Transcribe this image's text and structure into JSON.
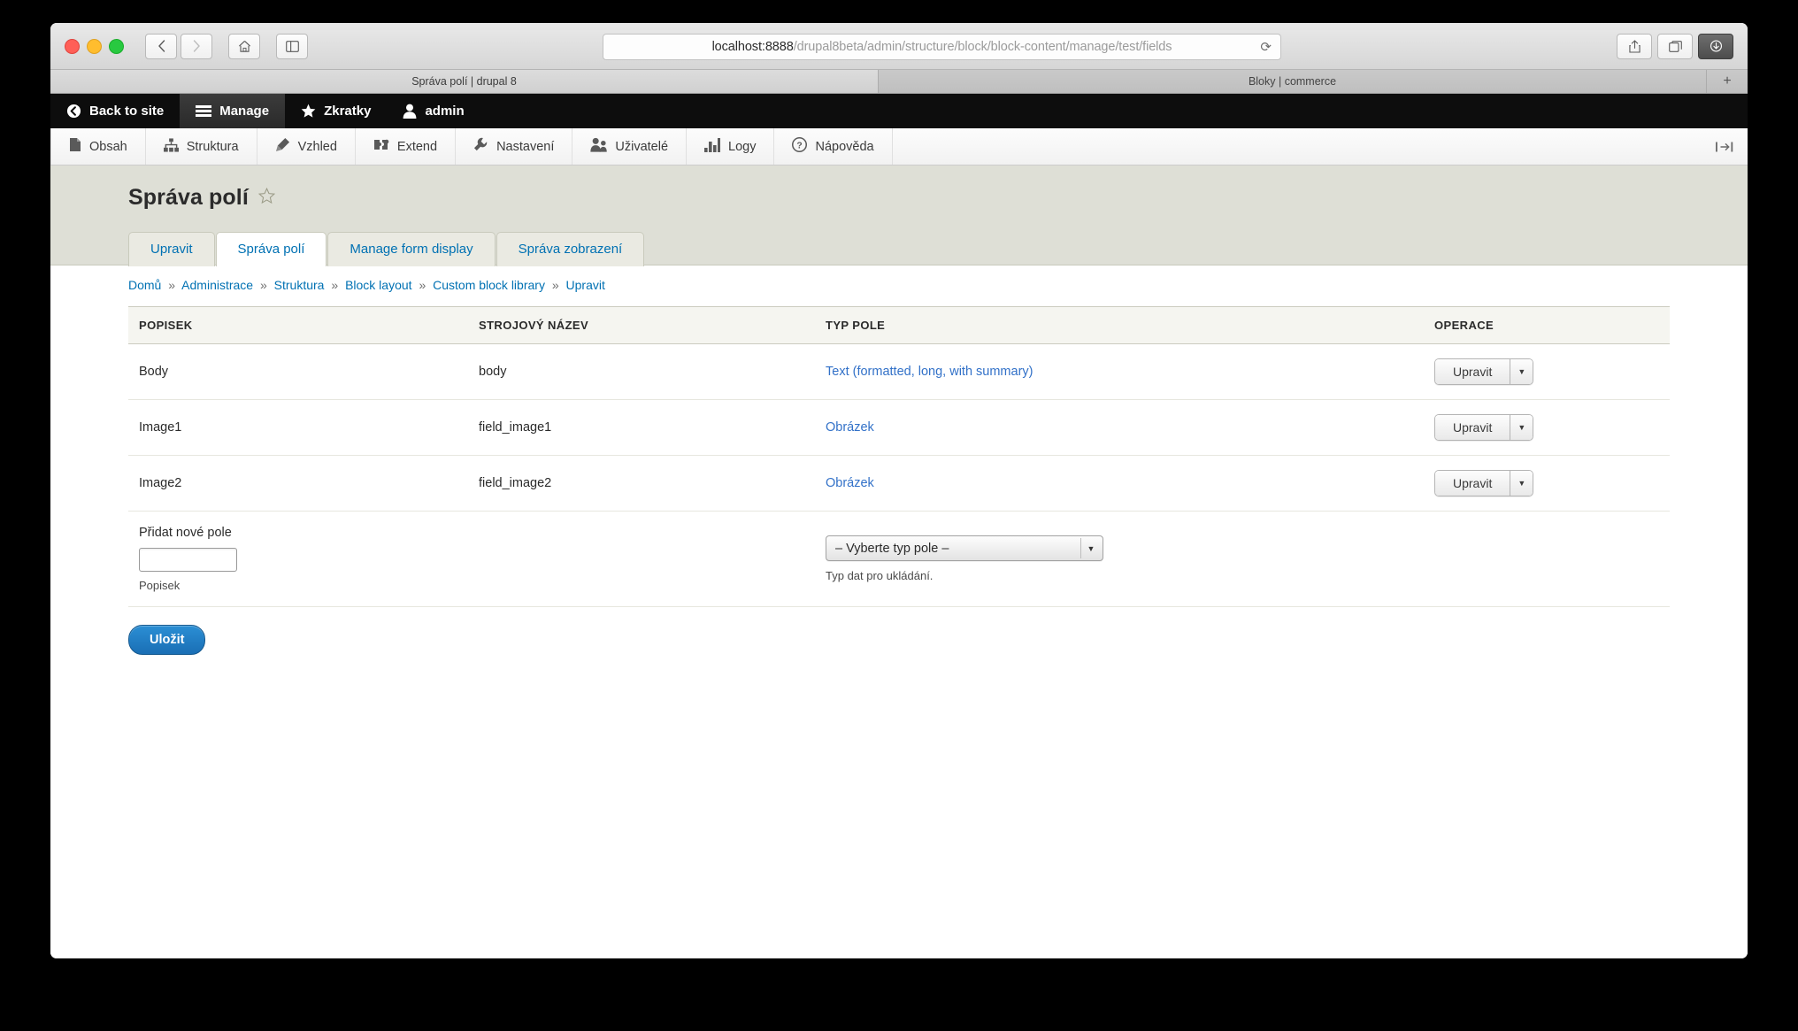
{
  "browser": {
    "url_host": "localhost:8888",
    "url_path": "/drupal8beta/admin/structure/block/block-content/manage/test/fields",
    "reload_icon": "reload-icon",
    "nav_back_icon": "back-arrow-icon",
    "nav_forward_icon": "forward-arrow-icon",
    "home_icon": "home-icon",
    "sidebar_icon": "sidebar-toggle-icon",
    "share_icon": "share-icon",
    "tabs_icon": "new-tab-icon",
    "download_icon": "download-icon",
    "tab_active_title": "Správa polí | drupal 8",
    "tab_second_title": "Bloky | commerce",
    "new_tab_label": "+"
  },
  "toolbar": {
    "back_to_site": "Back to site",
    "manage": "Manage",
    "shortcuts": "Zkratky",
    "account": "admin"
  },
  "admin_menu": {
    "items": [
      {
        "label": "Obsah",
        "icon": "content-page-icon"
      },
      {
        "label": "Struktura",
        "icon": "structure-sitemap-icon"
      },
      {
        "label": "Vzhled",
        "icon": "appearance-brush-icon"
      },
      {
        "label": "Extend",
        "icon": "extend-puzzle-icon"
      },
      {
        "label": "Nastavení",
        "icon": "settings-wrench-icon"
      },
      {
        "label": "Uživatelé",
        "icon": "people-users-icon"
      },
      {
        "label": "Logy",
        "icon": "reports-bars-icon"
      },
      {
        "label": "Nápověda",
        "icon": "help-question-icon"
      }
    ],
    "orientation_toggle_icon": "toolbar-orientation-icon"
  },
  "page": {
    "title": "Správa polí",
    "favorite_icon": "star-outline-icon",
    "tabs": [
      {
        "label": "Upravit",
        "active": false
      },
      {
        "label": "Správa polí",
        "active": true
      },
      {
        "label": "Manage form display",
        "active": false
      },
      {
        "label": "Správa zobrazení",
        "active": false
      }
    ],
    "breadcrumb": [
      "Domů",
      "Administrace",
      "Struktura",
      "Block layout",
      "Custom block library",
      "Upravit"
    ],
    "breadcrumb_separator": "»"
  },
  "table": {
    "headers": [
      "POPISEK",
      "STROJOVÝ NÁZEV",
      "TYP POLE",
      "OPERACE"
    ],
    "rows": [
      {
        "label": "Body",
        "machine_name": "body",
        "field_type": "Text (formatted, long, with summary)",
        "op_label": "Upravit",
        "op_arrow_icon": "chevron-down-icon"
      },
      {
        "label": "Image1",
        "machine_name": "field_image1",
        "field_type": "Obrázek",
        "op_label": "Upravit",
        "op_arrow_icon": "chevron-down-icon"
      },
      {
        "label": "Image2",
        "machine_name": "field_image2",
        "field_type": "Obrázek",
        "op_label": "Upravit",
        "op_arrow_icon": "chevron-down-icon"
      }
    ]
  },
  "add_field": {
    "title": "Přidat nové pole",
    "label_input_value": "",
    "label_caption": "Popisek",
    "select_value": "– Vyberte typ pole –",
    "select_caret_icon": "chevron-down-icon",
    "select_description": "Typ dat pro ukládání."
  },
  "actions": {
    "save_label": "Uložit"
  },
  "colors": {
    "link": "#3271c8",
    "tab_link": "#0071b3",
    "primary_button": "#1a6fb5",
    "header_bg": "#dedfd6",
    "toolbar_bg": "#0d0d0d"
  }
}
